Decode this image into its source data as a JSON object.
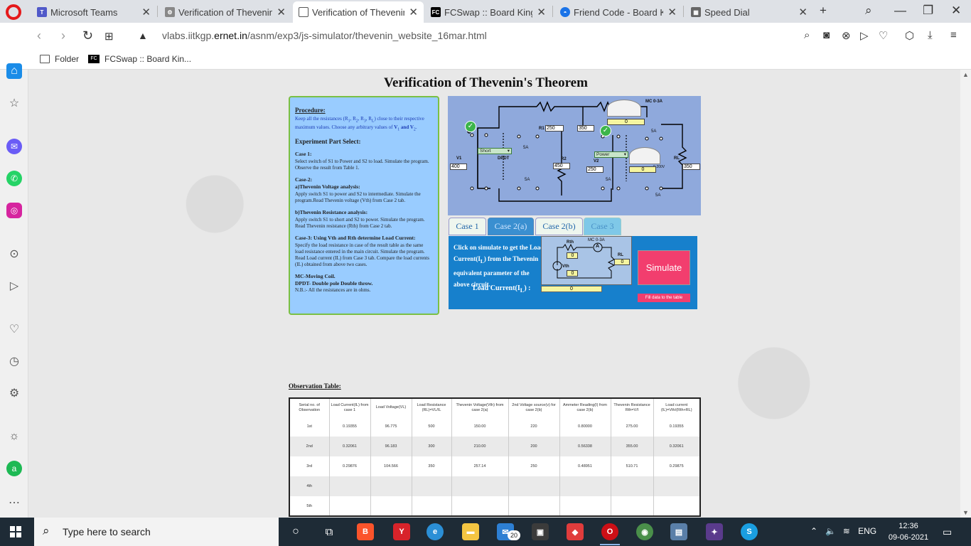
{
  "browser": {
    "tabs": [
      {
        "label": "Microsoft Teams",
        "icon": "teams-icon",
        "color": "#5059c9"
      },
      {
        "label": "Verification of Thevenin's",
        "icon": "vlabs-icon",
        "color": "#888888"
      },
      {
        "label": "Verification of Thevenin's",
        "icon": "page-icon",
        "color": "#555555",
        "active": true
      },
      {
        "label": "FCSwap :: Board Kings Fr",
        "icon": "fcswap-icon",
        "color": "#000000"
      },
      {
        "label": "Friend Code - Board King",
        "icon": "friend-code-icon",
        "color": "#1a73e8"
      },
      {
        "label": "Speed Dial",
        "icon": "speed-dial-icon",
        "color": "#666666"
      }
    ],
    "url_prefix": "vlabs.iitkgp.",
    "url_domain": "ernet.in",
    "url_path": "/asnm/exp3/js-simulator/thevenin_website_16mar.html",
    "bookmarks": [
      {
        "label": "Folder",
        "icon": "folder-icon"
      },
      {
        "label": "FCSwap :: Board Kin...",
        "icon": "fcswap-icon"
      }
    ]
  },
  "page": {
    "title": "Verification of Thevenin's Theorem",
    "procedure": {
      "heading": "Procedure:",
      "intro_a": "Keep all the resistances (R",
      "intro_b": "1",
      "intro_c": ", R",
      "intro_d": "2",
      "intro_e": ", R",
      "intro_f": "3",
      "intro_g": ", R",
      "intro_h": "L",
      "intro_i": ") close to their respective maximum values. Choose any arbitrary values of ",
      "intro_j": "V",
      "intro_k": "1",
      "intro_l": " and V",
      "intro_m": "2",
      "intro_n": ".",
      "part_select": "Experiment Part Select:",
      "case1_title": "Case 1:",
      "case1_text": "Select switch of S1 to Power and S2 to load. Simulate the program. Observe the result from Table 1.",
      "case2_title": "Case-2:",
      "case2a_title": "a)Thevenin Voltage analysis:",
      "case2a_text": "Apply switch S1 to power and S2 to intermediate. Simulate the program.Read Thevenin voltage (Vth) from Case 2 tab.",
      "case2b_title": "b)Thevenin Resistance analysis:",
      "case2b_text": "Apply switch S1 to short and S2 to power. Simulate the program. Read Thevenin resistance (Rth) from Case 2 tab.",
      "case3_title": "Case-3: Using Vth and Rth determine Load Current:",
      "case3_text": "Specify the load resistance in case of the result table as the same load resistance entered in the main circuit. Simulate the program. Read Load current (IL) from Case 3 tab. Compare the load currents (IL) obtained from above two cases.",
      "note1": "MC-Moving Coil.",
      "note2": "DPDT- Double pole Double throw.",
      "note3": "N.B.:- All the resistances are in ohms."
    },
    "circuit": {
      "meter_label": "MC 0-3A",
      "r1_label": "R1",
      "r1_value": "250",
      "r3_value": "350",
      "r2_label": "R2",
      "r2_value": "450",
      "v1_label": "V1",
      "v1_value": "400",
      "v2_label": "V2",
      "v2_value": "250",
      "rl_label": "RL",
      "rl_value": "350",
      "ammeter_reading": "0",
      "voltmeter_reading": "0",
      "s1_select": "Short",
      "s2_select": "Power",
      "dpdt_label": "DPDT",
      "fuse_label": "5A",
      "voltmeter_scale": "0-200V"
    },
    "case_tabs": [
      "Case 1",
      "Case 2(a)",
      "Case 2(b)",
      "Case 3"
    ],
    "case_panel": {
      "text_a": "Click on simulate to get the Load Current(I",
      "text_b": "L",
      "text_c": ") from the Thevenin equivalent parameter of the above circuit.",
      "load_current_a": "Load Current(I",
      "load_current_b": "L",
      "load_current_c": ")  :",
      "load_current_value": "0",
      "rth_label": "Rth",
      "vth_label": "Vth",
      "rl_label": "RL",
      "meter_label": "MC 0-3A",
      "rth_value": "0",
      "vth_value": "0",
      "rl_value": "0",
      "simulate_label": "Simulate",
      "fill_label": "Fill data to the table"
    },
    "observation": {
      "title": "Observation Table:",
      "headers": [
        "Serial no. of Observation",
        "Load Current(IL) from case 1",
        "Load Voltage(VL)",
        "Load Resistance (RL)=VL/IL",
        "Thevenin Voltage(Vth) from case 2(a)",
        "2nd Voltage source(v) for case 2(b)",
        "Ammeter Reading(I) from case 2(b)",
        "Thevenin Resistance Rth=V/I",
        "Load current (IL)=Vth/(Rth+RL)"
      ],
      "rows": [
        [
          "1st",
          "0.19355",
          "96.775",
          "500",
          "150.00",
          "220",
          "0.80000",
          "275.00",
          "0.19355"
        ],
        [
          "2nd",
          "0.32061",
          "96.183",
          "300",
          "210.00",
          "200",
          "0.56338",
          "355.00",
          "0.32061"
        ],
        [
          "3rd",
          "0.29876",
          "104.566",
          "350",
          "257.14",
          "250",
          "0.48951",
          "510.71",
          "0.29875"
        ],
        [
          "4th",
          "",
          "",
          "",
          "",
          "",
          "",
          "",
          ""
        ],
        [
          "5th",
          "",
          "",
          "",
          "",
          "",
          "",
          "",
          ""
        ]
      ]
    }
  },
  "taskbar": {
    "search_placeholder": "Type here to search",
    "mail_badge": "20",
    "language": "ENG",
    "time": "12:36",
    "date": "09-06-2021"
  },
  "colors": {
    "procedure_bg": "#99ccff",
    "procedure_border": "#7bc043",
    "circuit_bg": "#8fa9dc",
    "case_panel_bg": "#1780cc",
    "simulate_bg": "#f23e6e",
    "taskbar_bg": "#1e2b36"
  }
}
